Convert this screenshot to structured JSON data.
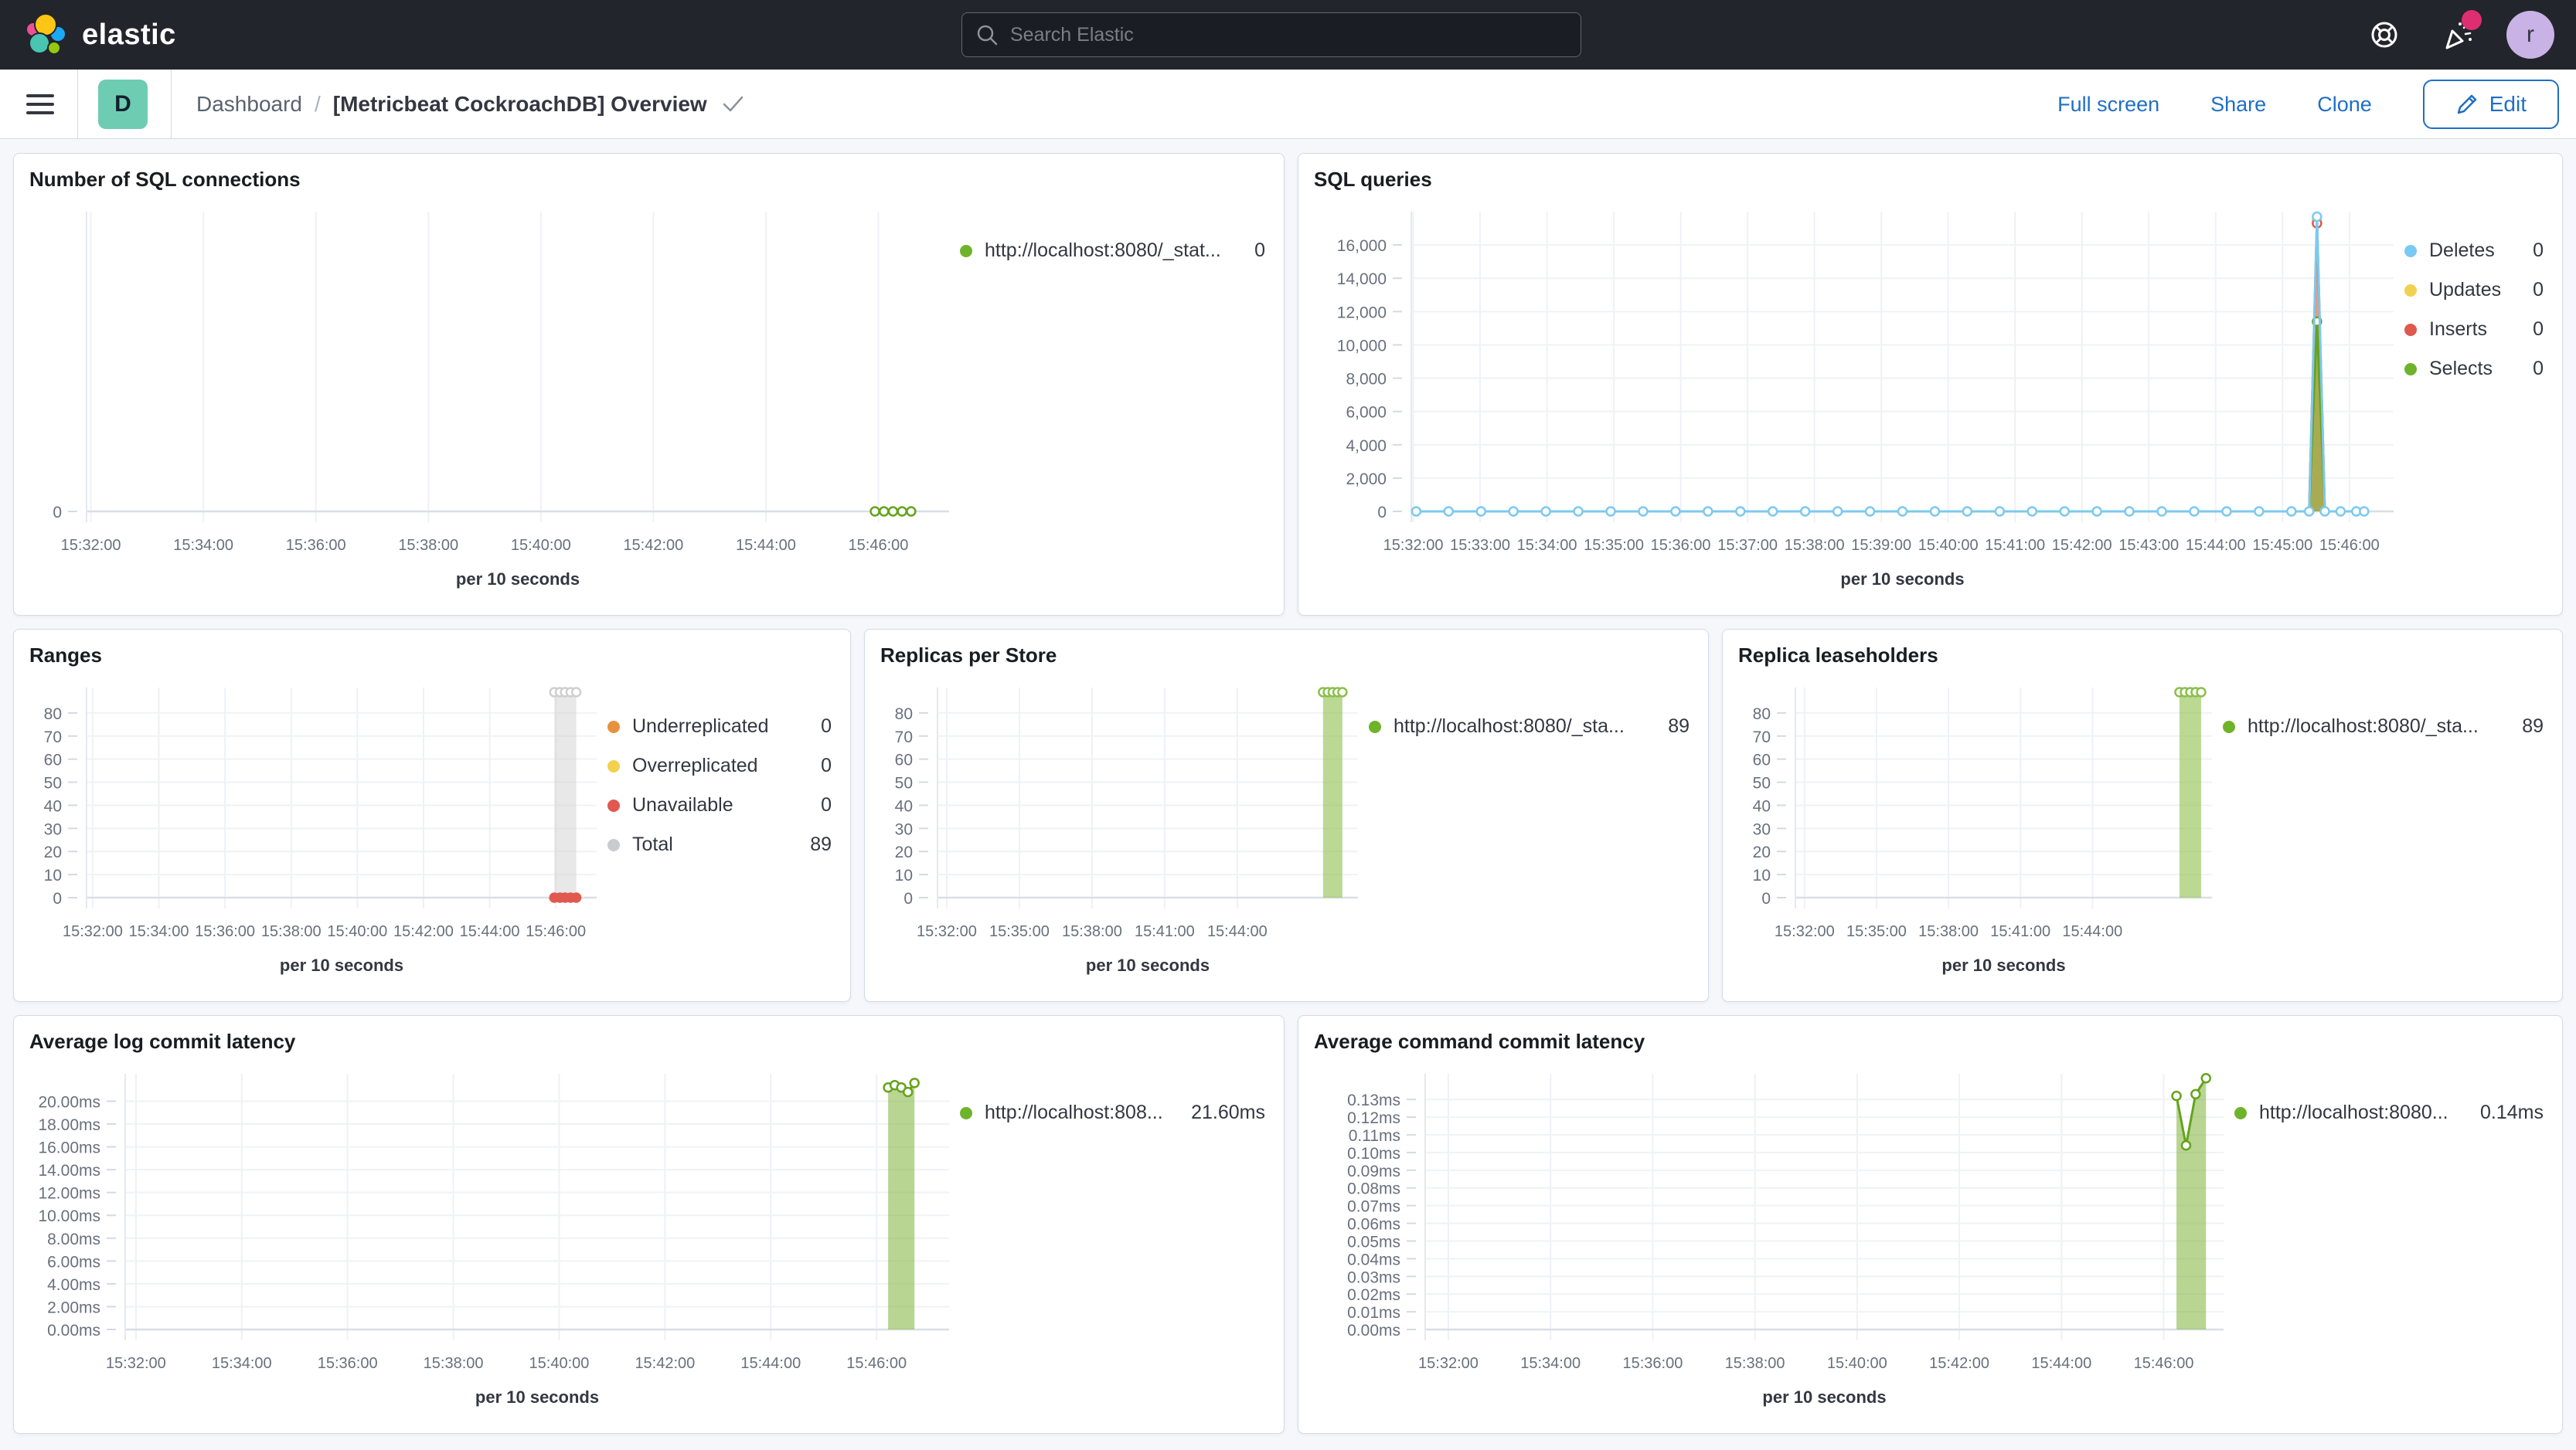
{
  "navbar": {
    "brand": "elastic",
    "search_placeholder": "Search Elastic",
    "avatar_initial": "r"
  },
  "toolbar": {
    "app_initial": "D",
    "breadcrumb_root": "Dashboard",
    "breadcrumb_sep": "/",
    "title": "[Metricbeat CockroachDB] Overview",
    "links": [
      "Full screen",
      "Share",
      "Clone"
    ],
    "edit_label": "Edit"
  },
  "colors": {
    "accent_blue": "#1f6fc4",
    "navbar_bg": "#23252c",
    "page_bg": "#f5f7fa",
    "panel_border": "#d3dae6",
    "series_green": "#6fb32a",
    "series_blue": "#79c9f2",
    "series_yellow": "#f1d14f",
    "series_red": "#e0584e",
    "series_orange": "#e8913d",
    "series_gray": "#c9cbce"
  },
  "charts": {
    "sql_connections": {
      "type": "line",
      "title": "Number of SQL connections",
      "x_axis_title": "per 10 seconds",
      "ylim": [
        0,
        8
      ],
      "y_ticks": [
        0
      ],
      "y_tick_labels": [
        "0"
      ],
      "x_ticks": [
        "15:32:00",
        "15:34:00",
        "15:36:00",
        "15:38:00",
        "15:40:00",
        "15:42:00",
        "15:44:00",
        "15:46:00"
      ],
      "x_tick_range": [
        0.005,
        0.918
      ],
      "margin_left": 80,
      "series": [
        {
          "name": "http://localhost:8080/_stat...",
          "type": "line",
          "color": "#65a31d",
          "markers": "hollow",
          "points": [
            [
              0.914,
              0
            ],
            [
              0.9245,
              0
            ],
            [
              0.935,
              0
            ],
            [
              0.9455,
              0
            ],
            [
              0.956,
              0
            ]
          ]
        }
      ],
      "legend": [
        {
          "label": "http://localhost:8080/_stat...",
          "value": "0",
          "color": "#6fb32a"
        }
      ]
    },
    "sql_queries": {
      "type": "line",
      "title": "SQL queries",
      "x_axis_title": "per 10 seconds",
      "ylim": [
        0,
        18000
      ],
      "y_ticks": [
        0,
        2000,
        4000,
        6000,
        8000,
        10000,
        12000,
        14000,
        16000
      ],
      "y_tick_labels": [
        "0",
        "2,000",
        "4,000",
        "6,000",
        "8,000",
        "10,000",
        "12,000",
        "14,000",
        "16,000"
      ],
      "x_ticks": [
        "15:32:00",
        "15:33:00",
        "15:34:00",
        "15:35:00",
        "15:36:00",
        "15:37:00",
        "15:38:00",
        "15:39:00",
        "15:40:00",
        "15:41:00",
        "15:42:00",
        "15:43:00",
        "15:44:00",
        "15:45:00",
        "15:46:00"
      ],
      "x_tick_range": [
        0.002,
        0.955
      ],
      "margin_left": 132,
      "series": [
        {
          "name": "Updates",
          "type": "area",
          "color": "#f1d14f",
          "fill": "rgba(241,209,79,0.5)",
          "markers": "hollow",
          "points": [
            [
              0.914,
              0
            ],
            [
              0.922,
              17500
            ],
            [
              0.93,
              0
            ]
          ],
          "marker_points": [
            [
              0.922,
              17500
            ]
          ]
        },
        {
          "name": "Inserts",
          "type": "area",
          "color": "#e0584e",
          "fill": "rgba(224,88,78,0.5)",
          "markers": "hollow",
          "points": [
            [
              0.914,
              0
            ],
            [
              0.922,
              17300
            ],
            [
              0.93,
              0
            ]
          ],
          "marker_points": [
            [
              0.922,
              17300
            ]
          ]
        },
        {
          "name": "Selects",
          "type": "area",
          "color": "#65a31d",
          "fill": "rgba(125,178,57,0.6)",
          "markers": "hollow",
          "points": [
            [
              0.914,
              0
            ],
            [
              0.922,
              11400
            ],
            [
              0.93,
              0
            ]
          ],
          "marker_points": [
            [
              0.922,
              11400
            ]
          ]
        },
        {
          "name": "Deletes",
          "type": "line",
          "color": "#7cc9ef",
          "markers": "hollow",
          "points": [
            [
              0.005,
              0
            ],
            [
              0.038,
              0
            ],
            [
              0.071,
              0
            ],
            [
              0.104,
              0
            ],
            [
              0.137,
              0
            ],
            [
              0.17,
              0
            ],
            [
              0.203,
              0
            ],
            [
              0.236,
              0
            ],
            [
              0.269,
              0
            ],
            [
              0.302,
              0
            ],
            [
              0.335,
              0
            ],
            [
              0.368,
              0
            ],
            [
              0.401,
              0
            ],
            [
              0.434,
              0
            ],
            [
              0.467,
              0
            ],
            [
              0.5,
              0
            ],
            [
              0.533,
              0
            ],
            [
              0.566,
              0
            ],
            [
              0.599,
              0
            ],
            [
              0.632,
              0
            ],
            [
              0.665,
              0
            ],
            [
              0.698,
              0
            ],
            [
              0.731,
              0
            ],
            [
              0.764,
              0
            ],
            [
              0.797,
              0
            ],
            [
              0.83,
              0
            ],
            [
              0.863,
              0
            ],
            [
              0.896,
              0
            ],
            [
              0.914,
              0
            ],
            [
              0.922,
              17700
            ],
            [
              0.93,
              0
            ],
            [
              0.946,
              0
            ],
            [
              0.962,
              0
            ],
            [
              0.97,
              0
            ]
          ]
        }
      ],
      "legend": [
        {
          "label": "Deletes",
          "value": "0",
          "color": "#79c9f2"
        },
        {
          "label": "Updates",
          "value": "0",
          "color": "#f1d14f"
        },
        {
          "label": "Inserts",
          "value": "0",
          "color": "#e0584e"
        },
        {
          "label": "Selects",
          "value": "0",
          "color": "#6fb32a"
        }
      ]
    },
    "ranges": {
      "type": "area",
      "title": "Ranges",
      "x_axis_title": "per 10 seconds",
      "ylim": [
        0,
        91
      ],
      "y_ticks": [
        0,
        10,
        20,
        30,
        40,
        50,
        60,
        70,
        80
      ],
      "y_tick_labels": [
        "0",
        "10",
        "20",
        "30",
        "40",
        "50",
        "60",
        "70",
        "80"
      ],
      "x_ticks": [
        "15:32:00",
        "15:34:00",
        "15:36:00",
        "15:38:00",
        "15:40:00",
        "15:42:00",
        "15:44:00",
        "15:46:00"
      ],
      "x_tick_range": [
        0.012,
        0.92
      ],
      "margin_left": 80,
      "series": [
        {
          "name": "Total",
          "type": "area",
          "color": "#cfcfcf",
          "fill": "rgba(205,205,205,0.45)",
          "markers": "hollow",
          "points": [
            [
              0.917,
              89
            ],
            [
              0.96,
              89
            ]
          ],
          "marker_points": [
            [
              0.917,
              89
            ],
            [
              0.928,
              89
            ],
            [
              0.938,
              89
            ],
            [
              0.949,
              89
            ],
            [
              0.96,
              89
            ]
          ]
        },
        {
          "name": "Unavailable",
          "type": "line",
          "color": "#e0584e",
          "markers": "solid",
          "points": [
            [
              0.917,
              0
            ],
            [
              0.928,
              0
            ],
            [
              0.938,
              0
            ],
            [
              0.949,
              0
            ],
            [
              0.96,
              0
            ]
          ]
        }
      ],
      "legend": [
        {
          "label": "Underreplicated",
          "value": "0",
          "color": "#e8913d"
        },
        {
          "label": "Overreplicated",
          "value": "0",
          "color": "#f1d14f"
        },
        {
          "label": "Unavailable",
          "value": "0",
          "color": "#e0584e"
        },
        {
          "label": "Total",
          "value": "89",
          "color": "#c9cbce"
        }
      ]
    },
    "replicas_per_store": {
      "type": "area",
      "title": "Replicas per Store",
      "x_axis_title": "per 10 seconds",
      "ylim": [
        0,
        91
      ],
      "y_ticks": [
        0,
        10,
        20,
        30,
        40,
        50,
        60,
        70,
        80
      ],
      "y_tick_labels": [
        "0",
        "10",
        "20",
        "30",
        "40",
        "50",
        "60",
        "70",
        "80"
      ],
      "x_ticks": [
        "15:32:00",
        "15:35:00",
        "15:38:00",
        "15:41:00",
        "15:44:00"
      ],
      "x_tick_range": [
        0.022,
        0.713
      ],
      "margin_left": 80,
      "series": [
        {
          "name": "http://localhost:8080/_sta...",
          "type": "area",
          "color": "#8bbf4a",
          "fill": "rgba(141,191,75,0.6)",
          "markers": "hollow",
          "points": [
            [
              0.917,
              89
            ],
            [
              0.963,
              89
            ]
          ],
          "marker_points": [
            [
              0.917,
              89
            ],
            [
              0.9285,
              89
            ],
            [
              0.94,
              89
            ],
            [
              0.9515,
              89
            ],
            [
              0.963,
              89
            ]
          ]
        }
      ],
      "legend": [
        {
          "label": "http://localhost:8080/_sta...",
          "value": "89",
          "color": "#6fb32a"
        }
      ]
    },
    "replica_leaseholders": {
      "type": "area",
      "title": "Replica leaseholders",
      "x_axis_title": "per 10 seconds",
      "ylim": [
        0,
        91
      ],
      "y_ticks": [
        0,
        10,
        20,
        30,
        40,
        50,
        60,
        70,
        80
      ],
      "y_tick_labels": [
        "0",
        "10",
        "20",
        "30",
        "40",
        "50",
        "60",
        "70",
        "80"
      ],
      "x_ticks": [
        "15:32:00",
        "15:35:00",
        "15:38:00",
        "15:41:00",
        "15:44:00"
      ],
      "x_tick_range": [
        0.022,
        0.713
      ],
      "margin_left": 80,
      "series": [
        {
          "name": "http://localhost:8080/_sta...",
          "type": "area",
          "color": "#8bbf4a",
          "fill": "rgba(141,191,75,0.6)",
          "markers": "hollow",
          "points": [
            [
              0.922,
              89
            ],
            [
              0.974,
              89
            ]
          ],
          "marker_points": [
            [
              0.922,
              89
            ],
            [
              0.935,
              89
            ],
            [
              0.948,
              89
            ],
            [
              0.961,
              89
            ],
            [
              0.974,
              89
            ]
          ]
        }
      ],
      "legend": [
        {
          "label": "http://localhost:8080/_sta...",
          "value": "89",
          "color": "#6fb32a"
        }
      ]
    },
    "avg_log_commit_latency": {
      "type": "area",
      "title": "Average log commit latency",
      "x_axis_title": "per 10 seconds",
      "ylim": [
        0,
        22.4
      ],
      "y_ticks": [
        0,
        2,
        4,
        6,
        8,
        10,
        12,
        14,
        16,
        18,
        20
      ],
      "y_tick_labels": [
        "0.00ms",
        "2.00ms",
        "4.00ms",
        "6.00ms",
        "8.00ms",
        "10.00ms",
        "12.00ms",
        "14.00ms",
        "16.00ms",
        "18.00ms",
        "20.00ms"
      ],
      "x_ticks": [
        "15:32:00",
        "15:34:00",
        "15:36:00",
        "15:38:00",
        "15:40:00",
        "15:42:00",
        "15:44:00",
        "15:46:00"
      ],
      "x_tick_range": [
        0.013,
        0.912
      ],
      "margin_left": 130,
      "series": [
        {
          "name": "http://localhost:808...",
          "type": "area",
          "color": "#65a31d",
          "fill": "rgba(125,178,57,0.55)",
          "markers": "hollow",
          "points": [
            [
              0.926,
              21.2
            ],
            [
              0.934,
              21.4
            ],
            [
              0.942,
              21.2
            ],
            [
              0.95,
              20.8
            ],
            [
              0.958,
              21.6
            ]
          ]
        }
      ],
      "legend": [
        {
          "label": "http://localhost:808...",
          "value": "21.60ms",
          "color": "#6fb32a"
        }
      ]
    },
    "avg_command_commit_latency": {
      "type": "area",
      "title": "Average command commit latency",
      "x_axis_title": "per 10 seconds",
      "ylim": [
        0,
        0.1445
      ],
      "y_ticks": [
        0,
        0.01,
        0.02,
        0.03,
        0.04,
        0.05,
        0.06,
        0.07,
        0.08,
        0.09,
        0.1,
        0.11,
        0.12,
        0.13
      ],
      "y_tick_labels": [
        "0.00ms",
        "0.01ms",
        "0.02ms",
        "0.03ms",
        "0.04ms",
        "0.05ms",
        "0.06ms",
        "0.07ms",
        "0.08ms",
        "0.09ms",
        "0.10ms",
        "0.11ms",
        "0.12ms",
        "0.13ms"
      ],
      "x_ticks": [
        "15:32:00",
        "15:34:00",
        "15:36:00",
        "15:38:00",
        "15:40:00",
        "15:42:00",
        "15:44:00",
        "15:46:00"
      ],
      "x_tick_range": [
        0.029,
        0.925
      ],
      "margin_left": 150,
      "series": [
        {
          "name": "http://localhost:8080...",
          "type": "area",
          "color": "#65a31d",
          "fill": "rgba(125,178,57,0.55)",
          "markers": "hollow",
          "points": [
            [
              0.941,
              0.132
            ],
            [
              0.953,
              0.104
            ],
            [
              0.965,
              0.133
            ],
            [
              0.978,
              0.142
            ]
          ]
        }
      ],
      "legend": [
        {
          "label": "http://localhost:8080...",
          "value": "0.14ms",
          "color": "#6fb32a"
        }
      ]
    }
  }
}
